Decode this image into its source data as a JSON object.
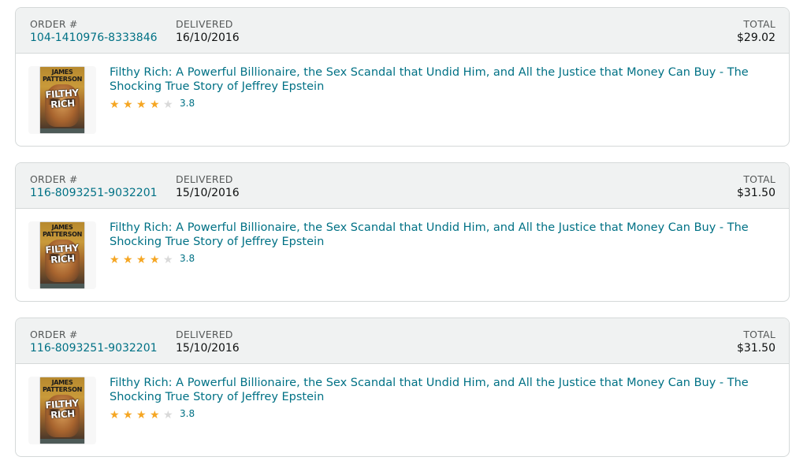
{
  "orders": [
    {
      "order_label": "ORDER #",
      "order_number": "104-1410976-8333846",
      "delivered_label": "DELIVERED",
      "delivered_date": "16/10/2016",
      "total_label": "TOTAL",
      "total": "$29.02",
      "item": {
        "cover_author": "JAMES PATTERSON",
        "cover_title": "FILTHY RICH",
        "title": "Filthy Rich: A Powerful Billionaire, the Sex Scandal that Undid Him, and All the Justice that Money Can Buy - The Shocking True Story of Jeffrey Epstein",
        "rating": "3.8",
        "stars_filled": 4,
        "stars_total": 5
      }
    },
    {
      "order_label": "ORDER #",
      "order_number": "116-8093251-9032201",
      "delivered_label": "DELIVERED",
      "delivered_date": "15/10/2016",
      "total_label": "TOTAL",
      "total": "$31.50",
      "item": {
        "cover_author": "JAMES PATTERSON",
        "cover_title": "FILTHY RICH",
        "title": "Filthy Rich: A Powerful Billionaire, the Sex Scandal that Undid Him, and All the Justice that Money Can Buy - The Shocking True Story of Jeffrey Epstein",
        "rating": "3.8",
        "stars_filled": 4,
        "stars_total": 5
      }
    },
    {
      "order_label": "ORDER #",
      "order_number": "116-8093251-9032201",
      "delivered_label": "DELIVERED",
      "delivered_date": "15/10/2016",
      "total_label": "TOTAL",
      "total": "$31.50",
      "item": {
        "cover_author": "JAMES PATTERSON",
        "cover_title": "FILTHY RICH",
        "title": "Filthy Rich: A Powerful Billionaire, the Sex Scandal that Undid Him, and All the Justice that Money Can Buy - The Shocking True Story of Jeffrey Epstein",
        "rating": "3.8",
        "stars_filled": 4,
        "stars_total": 5
      }
    }
  ],
  "icons": {
    "star": "star-icon"
  },
  "colors": {
    "link": "#007185",
    "star": "#f5a623",
    "star_empty": "#d9d9d9",
    "header_bg": "#f0f2f2",
    "border": "#d5d9d9"
  }
}
